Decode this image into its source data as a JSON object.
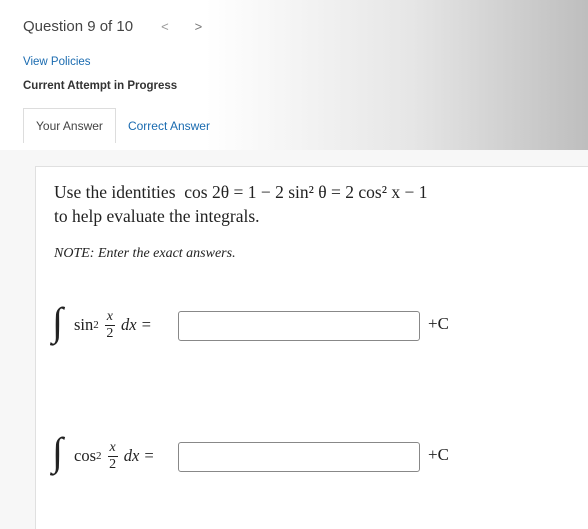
{
  "header": {
    "question_label": "Question 9 of 10",
    "prev_arrow": "<",
    "next_arrow": ">",
    "view_policies": "View Policies",
    "attempt_status": "Current Attempt in Progress"
  },
  "tabs": [
    {
      "label": "Your Answer",
      "active": true
    },
    {
      "label": "Correct Answer",
      "active": false
    }
  ],
  "question": {
    "line1_text": "Use the identities",
    "identity": "cos 2θ = 1 − 2 sin² θ = 2 cos² x − 1",
    "line2": "to help evaluate the integrals.",
    "note": "NOTE: Enter the exact answers."
  },
  "integrals": [
    {
      "integral_sign": "∫",
      "func": "sin",
      "power": "2",
      "frac_num": "x",
      "frac_den": "2",
      "dx": "dx =",
      "answer_value": "",
      "constant": "+C"
    },
    {
      "integral_sign": "∫",
      "func": "cos",
      "power": "2",
      "frac_num": "x",
      "frac_den": "2",
      "dx": "dx =",
      "answer_value": "",
      "constant": "+C"
    }
  ],
  "colors": {
    "link": "#1a6bb0",
    "text": "#333333",
    "panel_border": "#e0e0e0"
  }
}
